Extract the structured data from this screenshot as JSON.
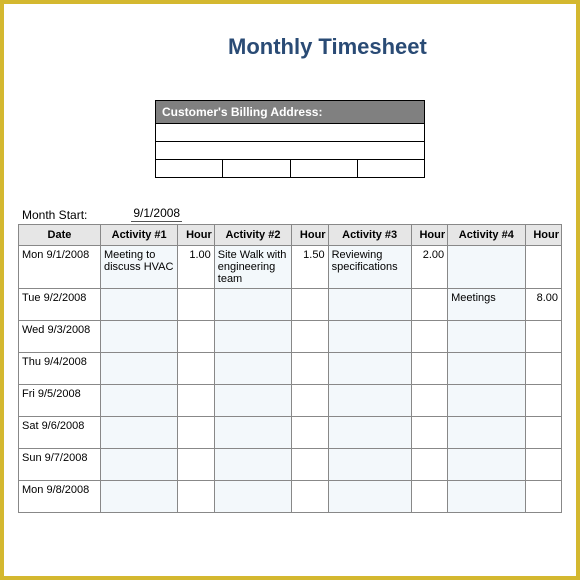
{
  "title": "Monthly Timesheet",
  "billing_header": "Customer's Billing Address:",
  "month_start_label": "Month Start:",
  "month_start_value": "9/1/2008",
  "headers": {
    "date": "Date",
    "activity1": "Activity #1",
    "hour1": "Hour",
    "activity2": "Activity #2",
    "hour2": "Hour",
    "activity3": "Activity #3",
    "hour3": "Hour",
    "activity4": "Activity #4",
    "hour4": "Hour"
  },
  "rows": [
    {
      "date": "Mon 9/1/2008",
      "a1": "Meeting to discuss HVAC",
      "h1": "1.00",
      "a2": "Site Walk with engineering team",
      "h2": "1.50",
      "a3": "Reviewing specifications",
      "h3": "2.00",
      "a4": "",
      "h4": ""
    },
    {
      "date": "Tue 9/2/2008",
      "a1": "",
      "h1": "",
      "a2": "",
      "h2": "",
      "a3": "",
      "h3": "",
      "a4": "Meetings",
      "h4": "8.00"
    },
    {
      "date": "Wed 9/3/2008",
      "a1": "",
      "h1": "",
      "a2": "",
      "h2": "",
      "a3": "",
      "h3": "",
      "a4": "",
      "h4": ""
    },
    {
      "date": "Thu 9/4/2008",
      "a1": "",
      "h1": "",
      "a2": "",
      "h2": "",
      "a3": "",
      "h3": "",
      "a4": "",
      "h4": ""
    },
    {
      "date": "Fri 9/5/2008",
      "a1": "",
      "h1": "",
      "a2": "",
      "h2": "",
      "a3": "",
      "h3": "",
      "a4": "",
      "h4": ""
    },
    {
      "date": "Sat 9/6/2008",
      "a1": "",
      "h1": "",
      "a2": "",
      "h2": "",
      "a3": "",
      "h3": "",
      "a4": "",
      "h4": ""
    },
    {
      "date": "Sun 9/7/2008",
      "a1": "",
      "h1": "",
      "a2": "",
      "h2": "",
      "a3": "",
      "h3": "",
      "a4": "",
      "h4": ""
    },
    {
      "date": "Mon 9/8/2008",
      "a1": "",
      "h1": "",
      "a2": "",
      "h2": "",
      "a3": "",
      "h3": "",
      "a4": "",
      "h4": ""
    }
  ]
}
